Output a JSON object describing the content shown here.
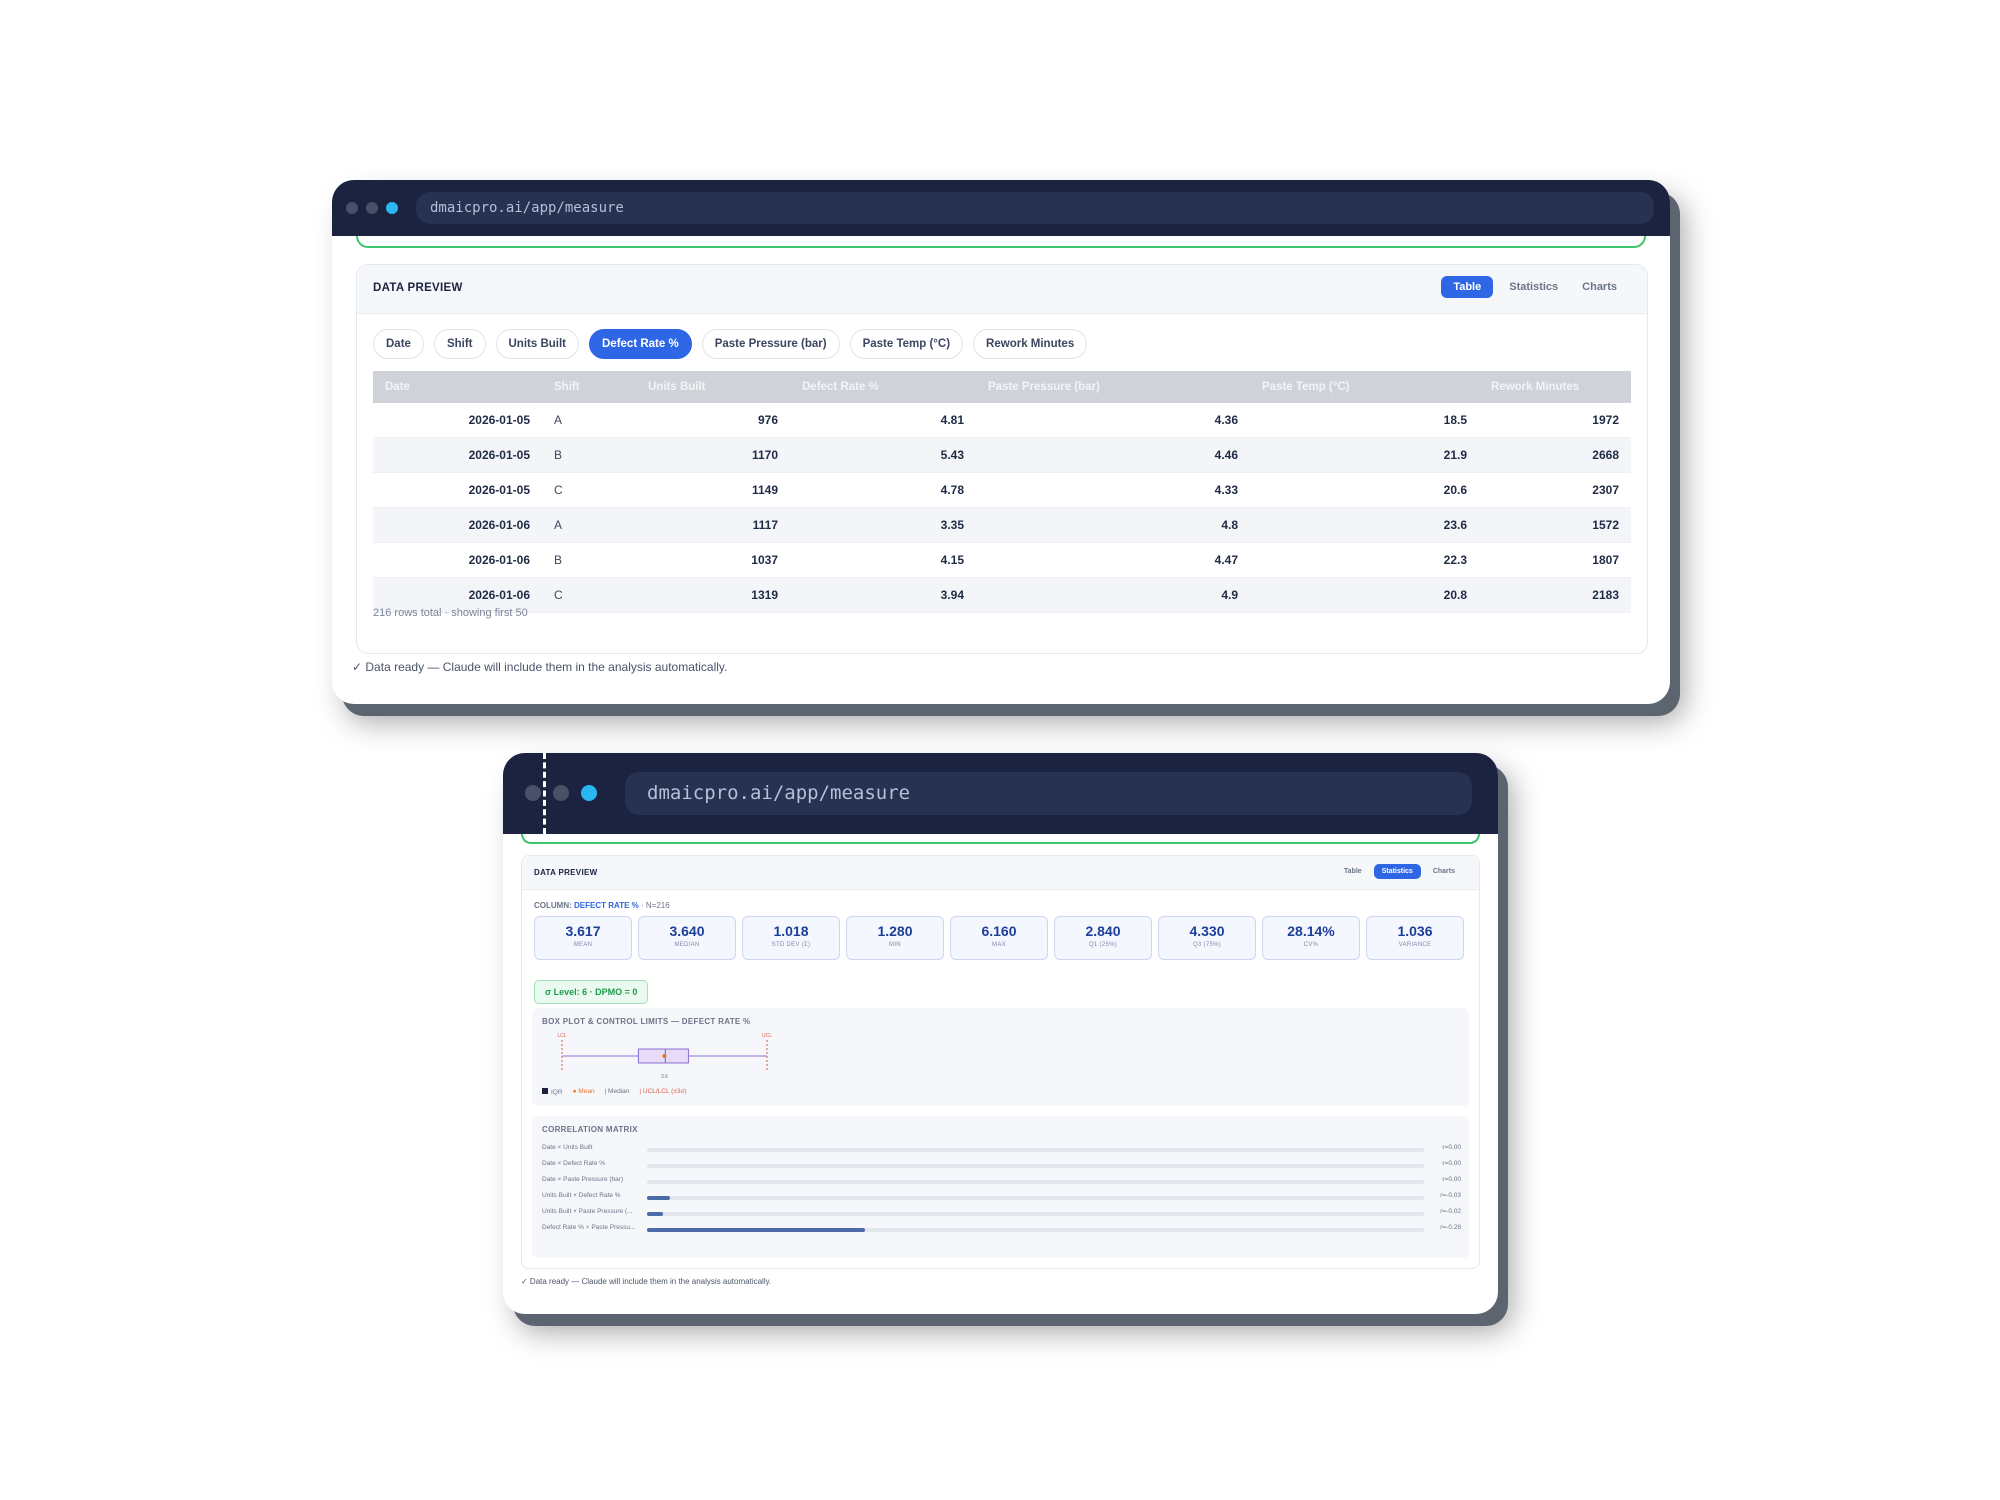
{
  "window1": {
    "url": "dmaicpro.ai/app/measure",
    "panel_title": "DATA PREVIEW",
    "view_tabs": [
      {
        "label": "Table",
        "active": true
      },
      {
        "label": "Statistics",
        "active": false
      },
      {
        "label": "Charts",
        "active": false
      }
    ],
    "column_chips": [
      {
        "label": "Date",
        "active": false
      },
      {
        "label": "Shift",
        "active": false
      },
      {
        "label": "Units Built",
        "active": false
      },
      {
        "label": "Defect Rate %",
        "active": true
      },
      {
        "label": "Paste Pressure (bar)",
        "active": false
      },
      {
        "label": "Paste Temp (°C)",
        "active": false
      },
      {
        "label": "Rework Minutes",
        "active": false
      }
    ],
    "table": {
      "headers": [
        "Date",
        "Shift",
        "Units Built",
        "Defect Rate %",
        "Paste Pressure (bar)",
        "Paste Temp (°C)",
        "Rework Minutes"
      ],
      "rows": [
        [
          "2026-01-05",
          "A",
          "976",
          "4.81",
          "4.36",
          "18.5",
          "1972"
        ],
        [
          "2026-01-05",
          "B",
          "1170",
          "5.43",
          "4.46",
          "21.9",
          "2668"
        ],
        [
          "2026-01-05",
          "C",
          "1149",
          "4.78",
          "4.33",
          "20.6",
          "2307"
        ],
        [
          "2026-01-06",
          "A",
          "1117",
          "3.35",
          "4.8",
          "23.6",
          "1572"
        ],
        [
          "2026-01-06",
          "B",
          "1037",
          "4.15",
          "4.47",
          "22.3",
          "1807"
        ],
        [
          "2026-01-06",
          "C",
          "1319",
          "3.94",
          "4.9",
          "20.8",
          "2183"
        ]
      ]
    },
    "footer": "216 rows total · showing first 50",
    "ready_text": "✓ Data ready — Claude will include them in the analysis automatically."
  },
  "window2": {
    "url": "dmaicpro.ai/app/measure",
    "panel_title": "DATA PREVIEW",
    "view_tabs": [
      {
        "label": "Table",
        "active": false
      },
      {
        "label": "Statistics",
        "active": true
      },
      {
        "label": "Charts",
        "active": false
      }
    ],
    "column_label_prefix": "COLUMN:",
    "column_name": "DEFECT RATE %",
    "column_n": "· N=216",
    "stats": [
      {
        "value": "3.617",
        "label": "MEAN"
      },
      {
        "value": "3.640",
        "label": "MEDIAN"
      },
      {
        "value": "1.018",
        "label": "STD DEV (Σ)"
      },
      {
        "value": "1.280",
        "label": "MIN"
      },
      {
        "value": "6.160",
        "label": "MAX"
      },
      {
        "value": "2.840",
        "label": "Q1 (25%)"
      },
      {
        "value": "4.330",
        "label": "Q3 (75%)"
      },
      {
        "value": "28.14%",
        "label": "CV%"
      },
      {
        "value": "1.036",
        "label": "VARIANCE"
      }
    ],
    "sigma_badge": "σ Level: 6 · DPMO = 0",
    "boxplot": {
      "title": "BOX PLOT & CONTROL LIMITS — DEFECT RATE %",
      "lcl_label": "LCL",
      "ucl_label": "UCL",
      "mean_label": "3.6",
      "legend": [
        {
          "label": "IQR",
          "color": "#1b2340"
        },
        {
          "label": "● Mean",
          "color": "#e8762b"
        },
        {
          "label": "| Median",
          "color": "#6b7488"
        },
        {
          "label": "| UCL/LCL (±3σ)",
          "color": "#e05a4a"
        }
      ],
      "stats": {
        "min": 1.28,
        "q1": 2.84,
        "median": 3.64,
        "mean": 3.617,
        "q3": 4.33,
        "max": 6.16
      }
    },
    "correlation": {
      "title": "CORRELATION MATRIX",
      "rows": [
        {
          "name": "Date × Units Built",
          "r": 0.0,
          "label": "r=0.00"
        },
        {
          "name": "Date × Defect Rate %",
          "r": 0.0,
          "label": "r=0.00"
        },
        {
          "name": "Date × Paste Pressure (bar)",
          "r": 0.0,
          "label": "r=0.00"
        },
        {
          "name": "Units Built × Defect Rate %",
          "r": -0.03,
          "label": "r=-0.03"
        },
        {
          "name": "Units Built × Paste Pressure (...",
          "r": -0.02,
          "label": "r=-0.02"
        },
        {
          "name": "Defect Rate % × Paste Pressu...",
          "r": -0.28,
          "label": "r=-0.28"
        }
      ]
    },
    "ready_text": "✓ Data ready — Claude will include them in the analysis automatically."
  }
}
